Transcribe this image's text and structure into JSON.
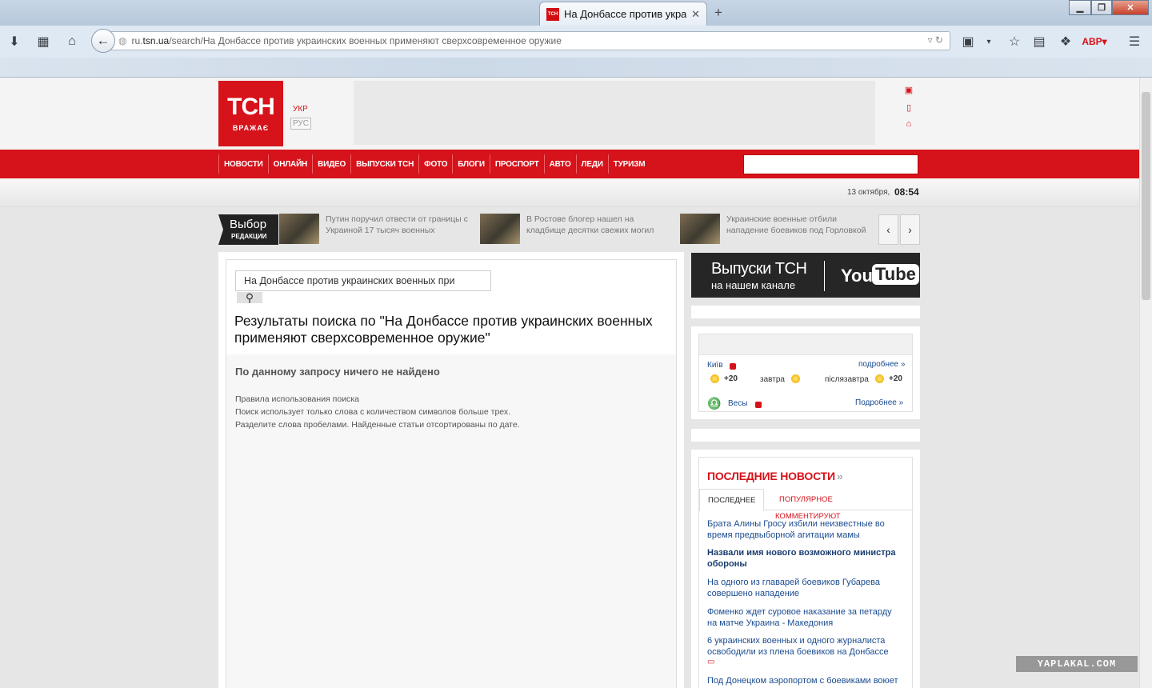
{
  "browser": {
    "tab_title": "На Донбассе против укра...",
    "tab_favicon_text": "ТСН",
    "url_host": "ru.tsn.ua",
    "url_path": "/search/На Донбассе против украинских военных применяют сверхсовременное оружие",
    "url_prefix": "ru.",
    "url_domain": "tsn.ua"
  },
  "header": {
    "logo_text": "ТСН",
    "logo_sub": "ВРАЖАЄ",
    "lang_ukr": "УКР",
    "lang_rus": "РУС"
  },
  "nav": {
    "items": [
      "НОВОСТИ",
      "ОНЛАЙН",
      "ВИДЕО",
      "ВЫПУСКИ ТСН",
      "ФОТО",
      "БЛОГИ",
      "ПРОСПОРТ",
      "АВТО",
      "ЛЕДИ",
      "ТУРИЗМ"
    ]
  },
  "datebar": {
    "date": "13 октября,",
    "time": "08:54"
  },
  "editor_pick": {
    "label1": "Выбор",
    "label2": "РЕДАКЦИИ",
    "items": [
      "Путин поручил отвести от границы с Украиной 17 тысяч военных",
      "В Ростове блогер нашел на кладбище десятки свежих могил",
      "Украинские военные отбили нападение боевиков под Горловкой"
    ]
  },
  "search": {
    "input_value": "На Донбассе против украинских военных при",
    "results_title": "Результаты поиска по \"На Донбассе против украинских военных применяют сверхсовременное оружие\"",
    "no_results": "По данному запросу ничего не найдено",
    "rules_heading": "Правила использования поиска",
    "rules_line1": "Поиск использует только слова с количеством символов больше трех.",
    "rules_line2": "Разделите слова пробелами. Найденные статьи отсортированы по дате."
  },
  "youtube": {
    "line1": "Выпуски ТСН",
    "line2": "на нашем канале",
    "you": "You",
    "tube": "Tube"
  },
  "weather": {
    "city": "Київ",
    "more": "подробнее »",
    "today_temp": "+20",
    "tomorrow": "завтра",
    "after": "післязавтра",
    "after_temp": "+20",
    "horoscope": "Весы",
    "horoscope_more": "Подробнее »"
  },
  "news": {
    "title": "ПОСЛЕДНИЕ НОВОСТИ",
    "tab_last": "ПОСЛЕДНЕЕ",
    "tab_popular": "ПОПУЛЯРНОЕ",
    "tab_comments": "КОММЕНТИРУЮТ",
    "items": [
      "Брата Алины Гросу избили неизвестные во время предвыборной агитации мамы",
      "Назвали имя нового возможного министра обороны",
      "На одного из главарей боевиков Губарева совершено нападение",
      "Фоменко ждет суровое наказание за петарду на матче Украина - Македония",
      "6 украинских военных и одного журналиста освободили из плена боевиков на Донбассе",
      "Под Донецком аэропортом с боевиками воюет сын Луценко - Геращенко"
    ]
  },
  "watermark": "YAPLAKAL.COM",
  "colors": {
    "brand_red": "#d6121a",
    "link_blue": "#1a4b8f"
  }
}
